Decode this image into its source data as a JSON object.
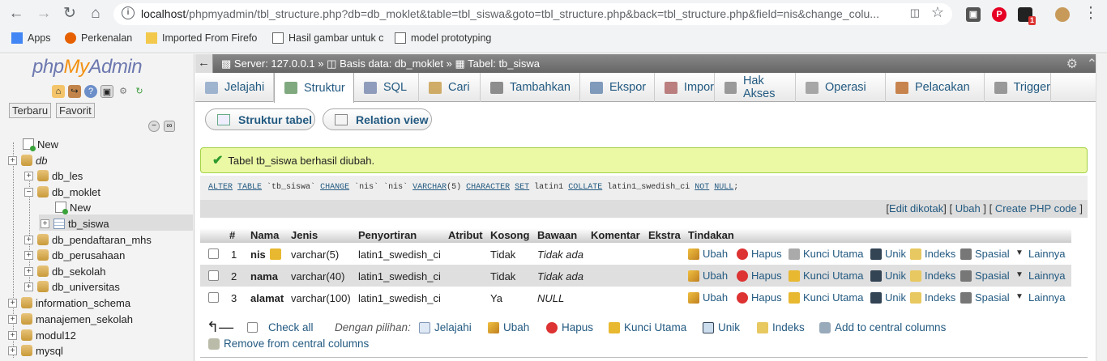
{
  "browser": {
    "url_host": "localhost",
    "url_rest": "/phpmyadmin/tbl_structure.php?db=db_moklet&table=tbl_siswa&goto=tbl_structure.php&back=tbl_structure.php&field=nis&change_colu...",
    "bookmarks": [
      {
        "label": "Apps",
        "icon": "apps-grid-icon"
      },
      {
        "label": "Perkenalan",
        "icon": "firefox-icon"
      },
      {
        "label": "Imported From Firefo",
        "icon": "folder-icon"
      },
      {
        "label": "Hasil gambar untuk c",
        "icon": "page-icon"
      },
      {
        "label": "model prototyping",
        "icon": "page-icon"
      }
    ],
    "ext_badge": "1"
  },
  "sidebar": {
    "logo_php": "php",
    "logo_my": "My",
    "logo_admin": "Admin",
    "tab_recent": "Terbaru",
    "tab_favorite": "Favorit",
    "tree": [
      {
        "label": "New",
        "level": 0,
        "type": "new"
      },
      {
        "label": "db",
        "level": 0,
        "type": "db",
        "italic": true,
        "exp": "+"
      },
      {
        "label": "db_les",
        "level": 1,
        "type": "db",
        "exp": "+"
      },
      {
        "label": "db_moklet",
        "level": 1,
        "type": "db",
        "exp": "−"
      },
      {
        "label": "New",
        "level": 2,
        "type": "new"
      },
      {
        "label": "tb_siswa",
        "level": 2,
        "type": "table",
        "exp": "+"
      },
      {
        "label": "db_pendaftaran_mhs",
        "level": 1,
        "type": "db",
        "exp": "+"
      },
      {
        "label": "db_perusahaan",
        "level": 1,
        "type": "db",
        "exp": "+"
      },
      {
        "label": "db_sekolah",
        "level": 1,
        "type": "db",
        "exp": "+"
      },
      {
        "label": "db_universitas",
        "level": 1,
        "type": "db",
        "exp": "+"
      },
      {
        "label": "information_schema",
        "level": 0,
        "type": "db",
        "exp": "+"
      },
      {
        "label": "manajemen_sekolah",
        "level": 0,
        "type": "db",
        "exp": "+"
      },
      {
        "label": "modul12",
        "level": 0,
        "type": "db",
        "exp": "+"
      },
      {
        "label": "mysql",
        "level": 0,
        "type": "db",
        "exp": "+"
      }
    ]
  },
  "topbar": {
    "server": "Server: 127.0.0.1",
    "database": "Basis data: db_moklet",
    "table": "Tabel: tb_siswa",
    "sep": "»"
  },
  "tabs": [
    {
      "label": "Jelajahi",
      "icon": "browse-icon"
    },
    {
      "label": "Struktur",
      "icon": "structure-icon",
      "active": true
    },
    {
      "label": "SQL",
      "icon": "sql-icon"
    },
    {
      "label": "Cari",
      "icon": "search-icon"
    },
    {
      "label": "Tambahkan",
      "icon": "insert-icon"
    },
    {
      "label": "Ekspor",
      "icon": "export-icon"
    },
    {
      "label": "Impor",
      "icon": "import-icon"
    },
    {
      "label": "Hak Akses",
      "icon": "privileges-icon"
    },
    {
      "label": "Operasi",
      "icon": "operations-icon"
    },
    {
      "label": "Pelacakan",
      "icon": "tracking-icon"
    },
    {
      "label": "Trigger",
      "icon": "trigger-icon"
    }
  ],
  "subtabs": {
    "structure": "Struktur tabel",
    "relation": "Relation view"
  },
  "message": {
    "success": "Tabel tb_siswa berhasil diubah.",
    "sql": [
      {
        "t": "ALTER",
        "k": 1
      },
      {
        "t": " "
      },
      {
        "t": "TABLE",
        "k": 1
      },
      {
        "t": " `tb_siswa` "
      },
      {
        "t": "CHANGE",
        "k": 1
      },
      {
        "t": " `nis` `nis` "
      },
      {
        "t": "VARCHAR",
        "k": 1
      },
      {
        "t": "(5) "
      },
      {
        "t": "CHARACTER",
        "k": 1
      },
      {
        "t": " "
      },
      {
        "t": "SET",
        "k": 1
      },
      {
        "t": " latin1 "
      },
      {
        "t": "COLLATE",
        "k": 1
      },
      {
        "t": " latin1_swedish_ci "
      },
      {
        "t": "NOT",
        "k": 1
      },
      {
        "t": " "
      },
      {
        "t": "NULL",
        "k": 1
      },
      {
        "t": ";"
      }
    ],
    "links": {
      "edit_inline": "Edit dikotak",
      "edit": "Ubah",
      "php": "Create PHP code"
    }
  },
  "table": {
    "headers": [
      "#",
      "Nama",
      "Jenis",
      "Penyortiran",
      "Atribut",
      "Kosong",
      "Bawaan",
      "Komentar",
      "Ekstra",
      "Tindakan"
    ],
    "rows": [
      {
        "num": "1",
        "name": "nis",
        "primary": true,
        "type": "varchar(5)",
        "collation": "latin1_swedish_ci",
        "attr": "",
        "null": "Tidak",
        "default": "Tidak ada",
        "comment": "",
        "extra": ""
      },
      {
        "num": "2",
        "name": "nama",
        "primary": false,
        "type": "varchar(40)",
        "collation": "latin1_swedish_ci",
        "attr": "",
        "null": "Tidak",
        "default": "Tidak ada",
        "comment": "",
        "extra": ""
      },
      {
        "num": "3",
        "name": "alamat",
        "primary": false,
        "type": "varchar(100)",
        "collation": "latin1_swedish_ci",
        "attr": "",
        "null": "Ya",
        "default": "NULL",
        "comment": "",
        "extra": ""
      }
    ],
    "actions": {
      "edit": "Ubah",
      "drop": "Hapus",
      "primary": "Kunci Utama",
      "unique": "Unik",
      "index": "Indeks",
      "spatial": "Spasial",
      "more": "Lainnya"
    }
  },
  "footer": {
    "check_all": "Check all",
    "with_selected": "Dengan pilihan:",
    "browse": "Jelajahi",
    "edit": "Ubah",
    "drop": "Hapus",
    "primary": "Kunci Utama",
    "unique": "Unik",
    "index": "Indeks",
    "add_central": "Add to central columns",
    "remove_central": "Remove from central columns"
  },
  "colors": {
    "link": "#235a81",
    "success_bg": "#ebf8a4",
    "success_border": "#a2d246",
    "logo_blue": "#6c78af",
    "logo_orange": "#f29111"
  }
}
